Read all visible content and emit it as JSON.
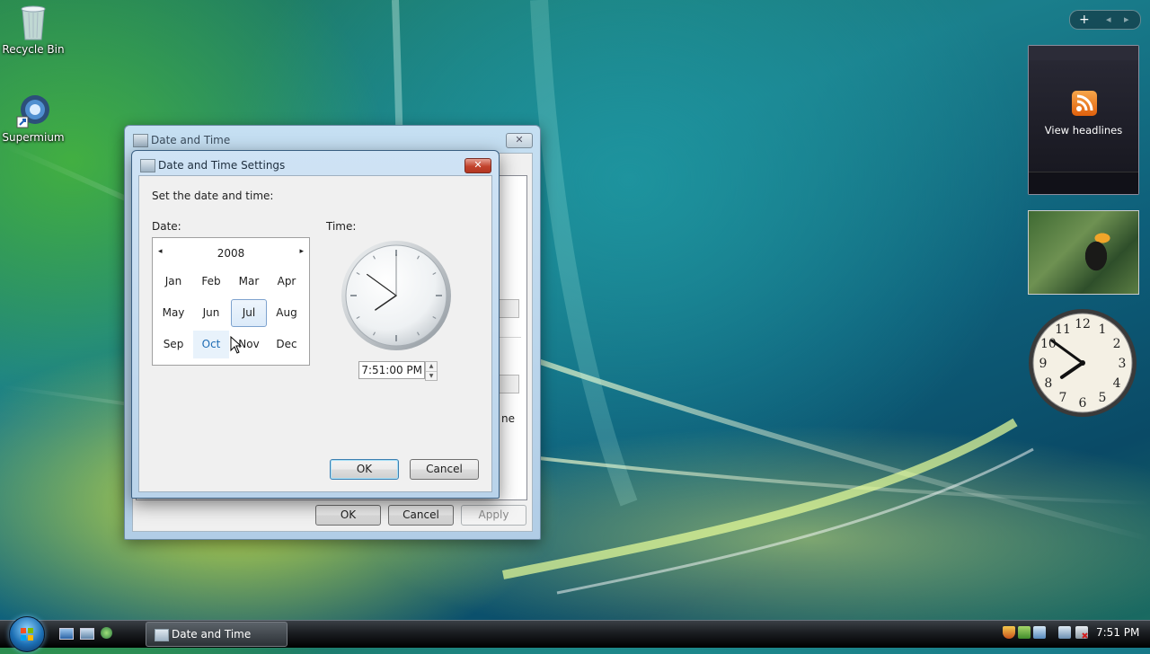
{
  "desktop": {
    "icons": [
      {
        "label": "Recycle Bin",
        "icon": "recycle-bin-icon"
      },
      {
        "label": "Supermium",
        "icon": "supermium-browser-icon"
      }
    ]
  },
  "sidebar": {
    "add_glyph": "+",
    "prev_glyph": "◂",
    "next_glyph": "▸",
    "feed_label": "View headlines",
    "clock": {
      "hour": 7,
      "minute": 51,
      "second": 0,
      "numerals": [
        "12",
        "1",
        "2",
        "3",
        "4",
        "5",
        "6",
        "7",
        "8",
        "9",
        "10",
        "11"
      ]
    }
  },
  "outer_dialog": {
    "title": "Date and Time",
    "close_glyph": "✕",
    "ok_label": "OK",
    "cancel_label": "Cancel",
    "apply_label": "Apply",
    "clipped_text": "ne"
  },
  "inner_dialog": {
    "title": "Date and Time Settings",
    "close_glyph": "✕",
    "instruction": "Set the date and time:",
    "date_label": "Date:",
    "time_label": "Time:",
    "calendar": {
      "year": "2008",
      "prev_glyph": "◂",
      "next_glyph": "▸",
      "months": [
        "Jan",
        "Feb",
        "Mar",
        "Apr",
        "May",
        "Jun",
        "Jul",
        "Aug",
        "Sep",
        "Oct",
        "Nov",
        "Dec"
      ],
      "selected": "Jul",
      "highlighted": "Oct"
    },
    "analog_clock": {
      "hour": 7,
      "minute": 51,
      "second": 0
    },
    "time_value": "7:51:00 PM",
    "spin_up": "▲",
    "spin_down": "▼",
    "ok_label": "OK",
    "cancel_label": "Cancel"
  },
  "taskbar": {
    "task_label": "Date and Time",
    "clock": "7:51 PM"
  },
  "colors": {
    "accent": "#3c7fb1",
    "close_red": "#c2432c",
    "taskbar": "#1a1d21"
  }
}
